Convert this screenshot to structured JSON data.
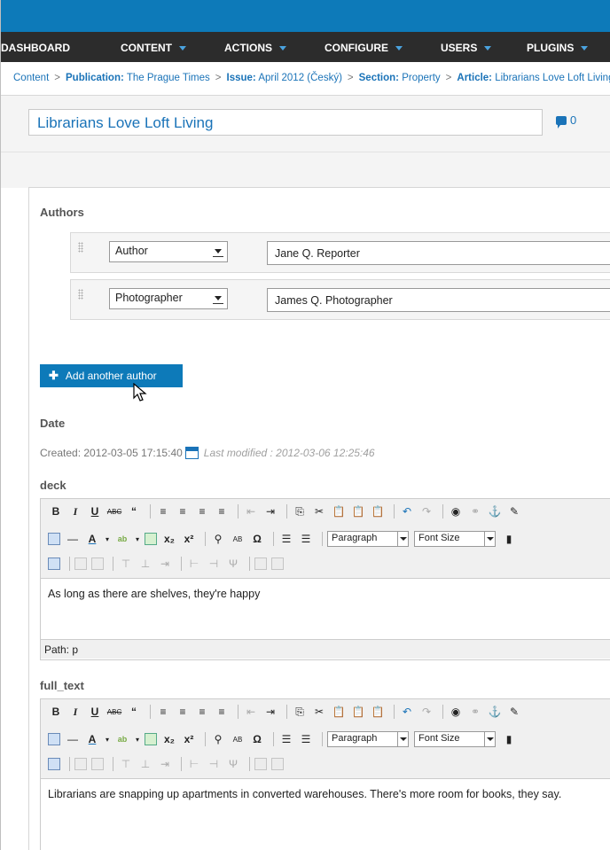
{
  "nav": {
    "items": [
      "DASHBOARD",
      "CONTENT",
      "ACTIONS",
      "CONFIGURE",
      "USERS",
      "PLUGINS"
    ]
  },
  "breadcrumb": {
    "content": "Content",
    "publication_label": "Publication:",
    "publication_value": "The Prague Times",
    "issue_label": "Issue:",
    "issue_value": "April 2012 (Český)",
    "section_label": "Section:",
    "section_value": "Property",
    "article_label": "Article:",
    "article_value": "Librarians Love Loft Living"
  },
  "article": {
    "title": "Librarians Love Loft Living",
    "comment_count": "0"
  },
  "authors": {
    "heading": "Authors",
    "rows": [
      {
        "role": "Author",
        "name": "Jane Q. Reporter"
      },
      {
        "role": "Photographer",
        "name": "James Q. Photographer"
      }
    ],
    "add_label": "Add another author"
  },
  "date": {
    "heading": "Date",
    "created": "Created: 2012-03-05 17:15:40",
    "last_modified": "Last modified : 2012-03-06 12:25:46"
  },
  "deck": {
    "label": "deck",
    "format": "Paragraph",
    "font_size": "Font Size",
    "text": "As long as there are shelves, they're happy",
    "path": "Path: p"
  },
  "full_text": {
    "label": "full_text",
    "format": "Paragraph",
    "font_size": "Font Size",
    "text": "Librarians are snapping up apartments in converted warehouses. There's more room for books, they say."
  },
  "colors": {
    "topbar": "#0d7ab9",
    "nav_bg": "#2c2c2c",
    "link": "#1a73b8"
  }
}
